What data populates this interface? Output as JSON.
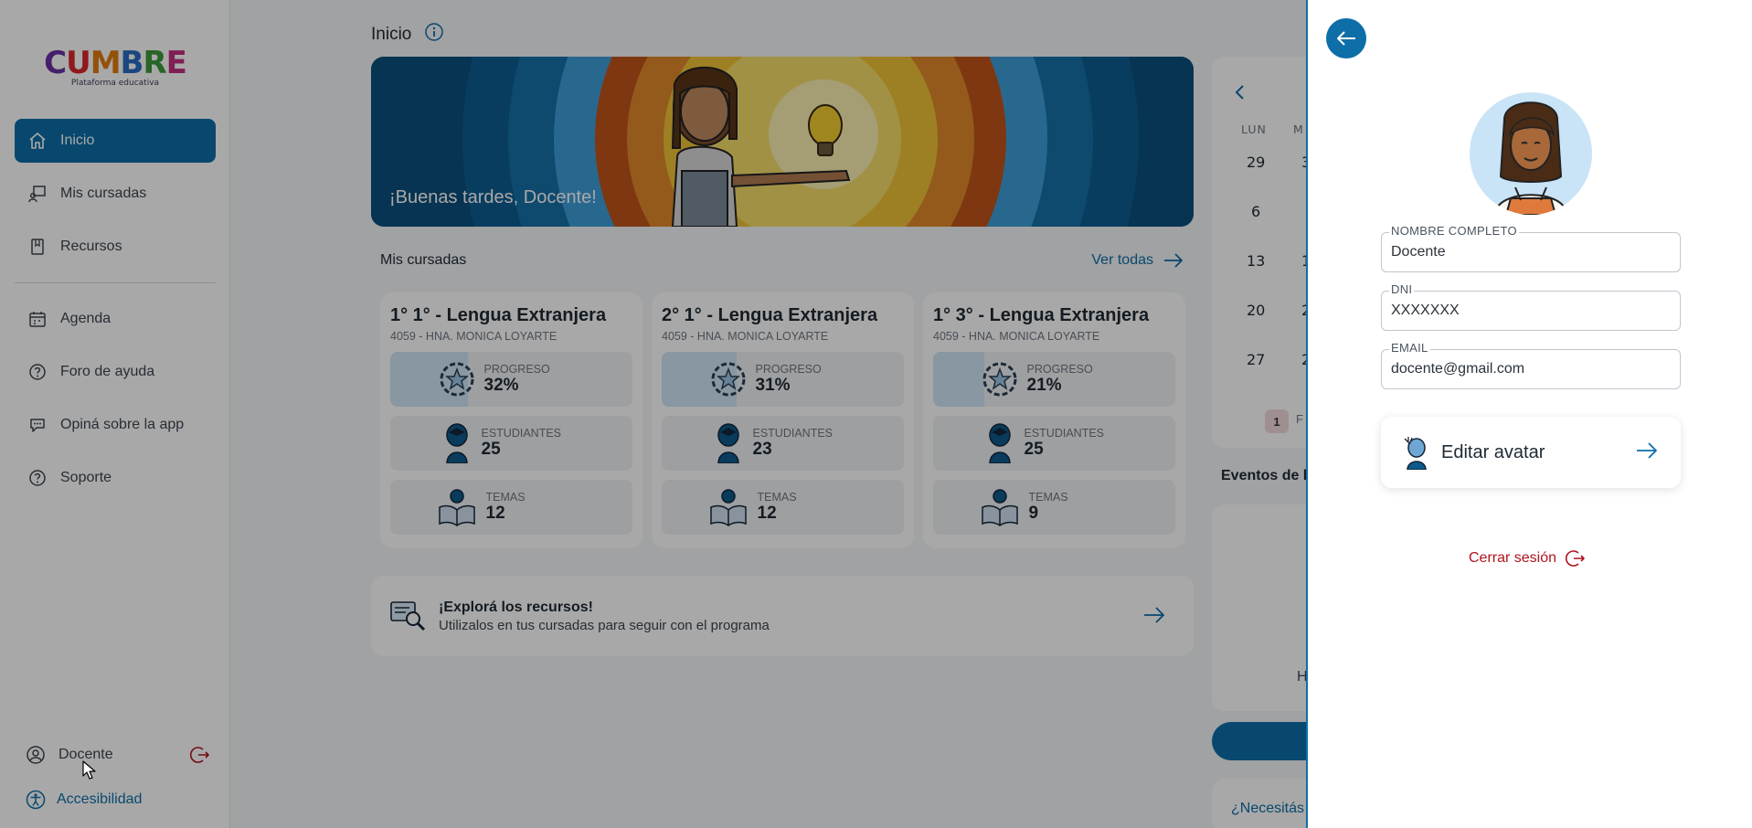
{
  "app": {
    "logo_text": "CUMBRE",
    "logo_letters": [
      "C",
      "U",
      "M",
      "B",
      "R",
      "E"
    ],
    "logo_subtitle": "Plataforma educativa"
  },
  "sidebar": {
    "items": [
      {
        "label": "Inicio",
        "icon": "home-icon",
        "active": true
      },
      {
        "label": "Mis cursadas",
        "icon": "classroom-icon",
        "active": false
      },
      {
        "label": "Recursos",
        "icon": "book-icon",
        "active": false
      },
      {
        "label": "Agenda",
        "icon": "calendar-icon",
        "active": false
      },
      {
        "label": "Foro de ayuda",
        "icon": "help-icon",
        "active": false
      },
      {
        "label": "Opiná sobre la app",
        "icon": "chat-icon",
        "active": false
      },
      {
        "label": "Soporte",
        "icon": "help-icon",
        "active": false
      }
    ],
    "user_label": "Docente",
    "accessibility_label": "Accesibilidad"
  },
  "main": {
    "title": "Inicio",
    "greeting": "¡Buenas tardes, Docente!",
    "courses_section_label": "Mis cursadas",
    "see_all_label": "Ver todas",
    "courses": [
      {
        "title": "1° 1° - Lengua Extranjera",
        "school": "4059 - HNA. MONICA LOYARTE",
        "progress_label": "PROGRESO",
        "progress": "32%",
        "progress_fraction": 0.32,
        "students_label": "ESTUDIANTES",
        "students": "25",
        "topics_label": "TEMAS",
        "topics": "12"
      },
      {
        "title": "2° 1° - Lengua Extranjera",
        "school": "4059 - HNA. MONICA LOYARTE",
        "progress_label": "PROGRESO",
        "progress": "31%",
        "progress_fraction": 0.31,
        "students_label": "ESTUDIANTES",
        "students": "23",
        "topics_label": "TEMAS",
        "topics": "12"
      },
      {
        "title": "1° 3° - Lengua Extranjera",
        "school": "4059 - HNA. MONICA LOYARTE",
        "progress_label": "PROGRESO",
        "progress": "21%",
        "progress_fraction": 0.21,
        "students_label": "ESTUDIANTES",
        "students": "25",
        "topics_label": "TEMAS",
        "topics": "9"
      }
    ],
    "resources": {
      "title": "¡Explorá los recursos!",
      "subtitle": "Utilizalos en tus cursadas para seguir con el programa"
    }
  },
  "calendar": {
    "weekdays": [
      "LUN",
      "M"
    ],
    "days": [
      "29",
      "3",
      "6",
      "13",
      "1",
      "20",
      "2",
      "27",
      "2"
    ],
    "page_current": "1",
    "page_next_fragment": "F"
  },
  "events": {
    "heading_fragment": "Eventos de h",
    "body_fragment": "H"
  },
  "help": {
    "text_fragment": "¿Necesitás"
  },
  "profile": {
    "fields": [
      {
        "label": "NOMBRE COMPLETO",
        "value": "Docente"
      },
      {
        "label": "DNI",
        "value": "XXXXXXX"
      },
      {
        "label": "EMAIL",
        "value": "docente@gmail.com"
      }
    ],
    "edit_avatar_label": "Editar avatar",
    "logout_label": "Cerrar sesión"
  },
  "colors": {
    "primary": "#0d6ea8",
    "danger": "#b0141f",
    "overlay": "rgba(0,0,0,0.34)"
  }
}
